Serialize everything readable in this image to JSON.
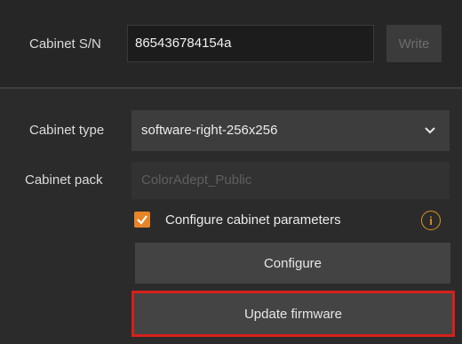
{
  "serial": {
    "label": "Cabinet S/N",
    "value": "865436784154a",
    "write_label": "Write"
  },
  "cabinet_type": {
    "label": "Cabinet type",
    "selected": "software-right-256x256"
  },
  "cabinet_pack": {
    "label": "Cabinet pack",
    "placeholder": "ColorAdept_Public"
  },
  "configure_params": {
    "label": "Configure cabinet parameters",
    "checked": true,
    "info_icon": "info-icon"
  },
  "buttons": {
    "configure": "Configure",
    "update_firmware": "Update firmware"
  },
  "colors": {
    "accent_orange": "#e58528",
    "highlight_red": "#d6201a",
    "background": "#2b2b2b"
  }
}
